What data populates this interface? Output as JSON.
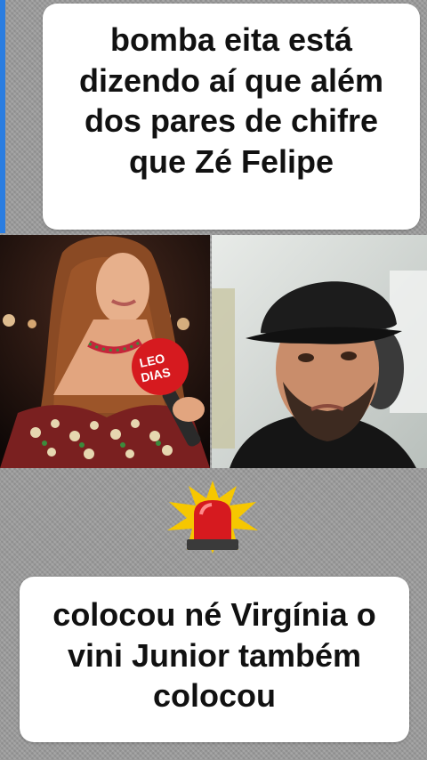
{
  "caption_top": {
    "lines": [
      "bomba eita está",
      "dizendo  aí que além",
      "dos pares de chifre",
      "que Zé Felipe"
    ]
  },
  "microphone": {
    "brand_line1": "LEO",
    "brand_line2": "DIAS"
  },
  "caption_bottom": {
    "lines": [
      "colocou né Virgínia o",
      "vini  Junior  também",
      "colocou"
    ]
  },
  "icons": {
    "alert": "siren-icon"
  },
  "colors": {
    "mic_red": "#d61a1f",
    "accent_blue": "#2a7de1",
    "siren_yellow": "#f6c700"
  }
}
